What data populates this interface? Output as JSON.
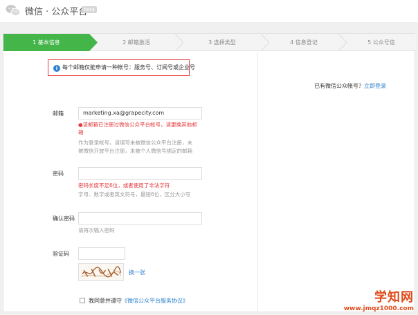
{
  "header": {
    "title": "微信 · 公众平台",
    "beta": "beta"
  },
  "steps": [
    {
      "label": "1 基本信息",
      "active": true
    },
    {
      "label": "2 邮箱激活",
      "active": false
    },
    {
      "label": "3 选择类型",
      "active": false
    },
    {
      "label": "4 信息登记",
      "active": false
    },
    {
      "label": "5 公众号信",
      "active": false
    }
  ],
  "tip": {
    "text": "每个邮箱仅能申请一种帐号：服务号、订阅号或企业号"
  },
  "form": {
    "email": {
      "label": "邮箱",
      "value": "marketing.xa@grapecity.com",
      "error_line1": "●该邮箱已注册过微信公众平台帐号，请更换其他邮",
      "error_line2": "箱",
      "hint_line1": "作为登录帐号，请填写未被微信公众平台注册，未",
      "hint_line2": "被微信开放平台注册，未被个人微信号绑定的邮箱"
    },
    "password": {
      "label": "密码",
      "value": "",
      "error": "密码长度不足6位，或者使用了非法字符",
      "hint": "字母、数字或者英文符号，最短6位，区分大小写"
    },
    "confirm": {
      "label": "确认密码",
      "value": "",
      "hint": "请再次输入密码"
    },
    "captcha": {
      "label": "验证码",
      "value": "",
      "change_label": "换一张"
    },
    "agree": {
      "text": "我同意并遵守",
      "link": "《微信公众平台服务协议》"
    }
  },
  "side": {
    "text": "已有微信公众帐号？",
    "link": "立即登录"
  },
  "watermark": {
    "title": "学知网",
    "url": "www.jmqz1000.com"
  },
  "colors": {
    "accent_green": "#44b549",
    "error_red": "#e4393c",
    "link_blue": "#2e82d0"
  }
}
